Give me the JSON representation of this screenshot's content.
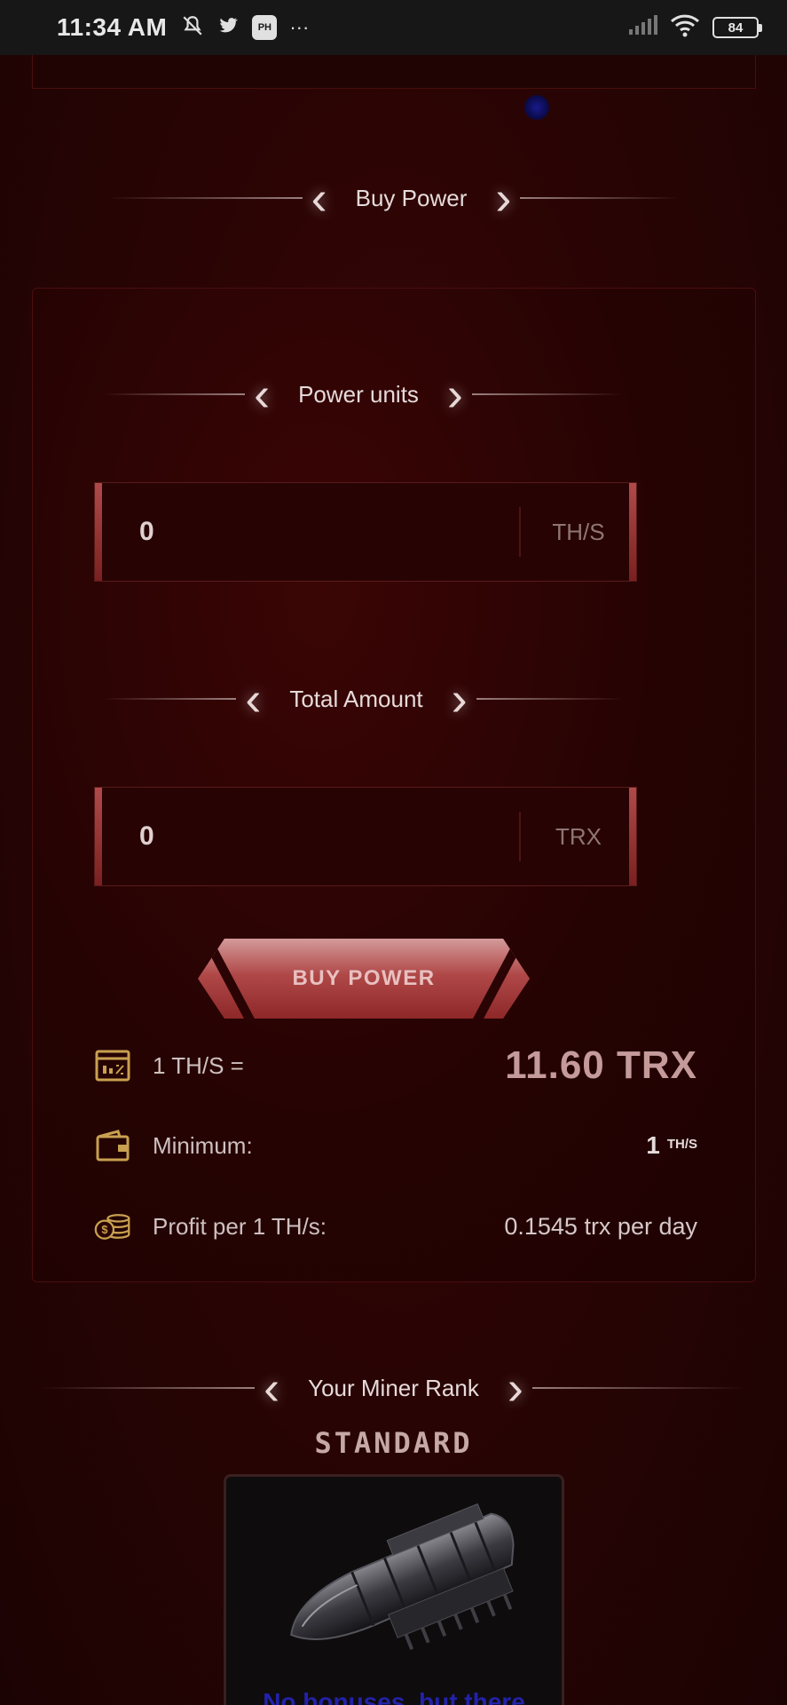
{
  "status_bar": {
    "time": "11:34 AM",
    "ph_badge": "PH",
    "more": "···",
    "battery": "84"
  },
  "sections": {
    "buy_power": "Buy Power",
    "power_units": "Power units",
    "total_amount": "Total Amount",
    "miner_rank": "Your Miner Rank"
  },
  "inputs": {
    "power_units": {
      "value": "0",
      "unit": "TH/S"
    },
    "total_amount": {
      "value": "0",
      "unit": "TRX"
    }
  },
  "buy_button": "BUY POWER",
  "info": {
    "rate_label": "1 TH/S =",
    "rate_value": "11.60 TRX",
    "minimum_label": "Minimum:",
    "minimum_value": "1",
    "minimum_unit": "TH/S",
    "profit_label": "Profit per 1 TH/s:",
    "profit_value": "0.1545 trx per day"
  },
  "rank": {
    "name": "STANDARD",
    "footer_text": "No bonuses, but there"
  },
  "icons": {
    "rate": "calculator-window-icon",
    "minimum": "wallet-icon",
    "profit": "coins-icon"
  },
  "colors": {
    "background": "#2a0404",
    "accent": "#b04848",
    "gold_icons": "#c8a050"
  }
}
